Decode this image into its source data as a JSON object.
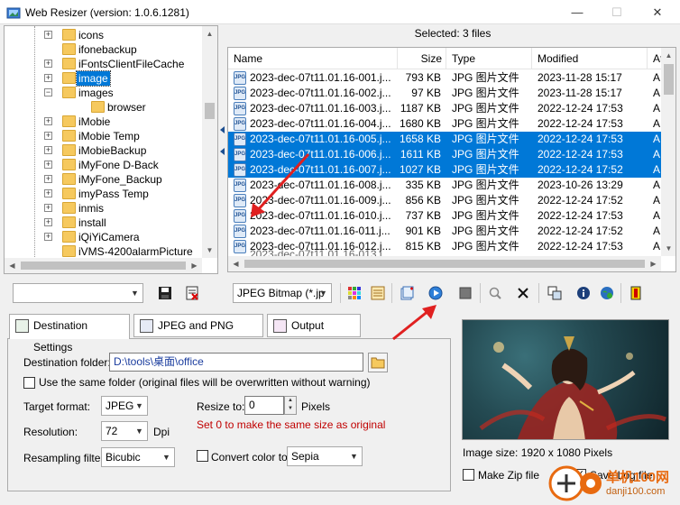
{
  "window": {
    "title": "Web Resizer (version: 1.0.6.1281)",
    "controls": {
      "minimize": "—",
      "maximize": "☐",
      "close": "✕"
    }
  },
  "tree": {
    "items": [
      {
        "label": "icons",
        "selected": false,
        "has_expander": true
      },
      {
        "label": "ifonebackup",
        "selected": false,
        "has_expander": false
      },
      {
        "label": "iFontsClientFileCache",
        "selected": false,
        "has_expander": true
      },
      {
        "label": "image",
        "selected": true,
        "has_expander": true
      },
      {
        "label": "images",
        "selected": false,
        "has_expander": true,
        "expanded": true
      },
      {
        "label": "browser",
        "selected": false,
        "has_expander": false,
        "child": true
      },
      {
        "label": "iMobie",
        "selected": false,
        "has_expander": true
      },
      {
        "label": "iMobie Temp",
        "selected": false,
        "has_expander": true
      },
      {
        "label": "iMobieBackup",
        "selected": false,
        "has_expander": true
      },
      {
        "label": "iMyFone D-Back",
        "selected": false,
        "has_expander": true
      },
      {
        "label": "iMyFone_Backup",
        "selected": false,
        "has_expander": true
      },
      {
        "label": "imyPass Temp",
        "selected": false,
        "has_expander": true
      },
      {
        "label": "inmis",
        "selected": false,
        "has_expander": true
      },
      {
        "label": "install",
        "selected": false,
        "has_expander": true
      },
      {
        "label": "iQiYiCamera",
        "selected": false,
        "has_expander": true
      },
      {
        "label": "iVMS-4200alarmPicture",
        "selected": false,
        "has_expander": false
      }
    ]
  },
  "file_list": {
    "selected_text": "Selected: 3 files",
    "columns": [
      "Name",
      "Size",
      "Type",
      "Modified",
      "Att"
    ],
    "rows": [
      {
        "name": "2023-dec-07t11.01.16-001.j...",
        "size": "793 KB",
        "type": "JPG 图片文件",
        "modified": "2023-11-28 15:17",
        "attr": "A",
        "selected": false
      },
      {
        "name": "2023-dec-07t11.01.16-002.j...",
        "size": "97 KB",
        "type": "JPG 图片文件",
        "modified": "2023-11-28 15:17",
        "attr": "A",
        "selected": false
      },
      {
        "name": "2023-dec-07t11.01.16-003.j...",
        "size": "1187 KB",
        "type": "JPG 图片文件",
        "modified": "2022-12-24 17:53",
        "attr": "A",
        "selected": false
      },
      {
        "name": "2023-dec-07t11.01.16-004.j...",
        "size": "1680 KB",
        "type": "JPG 图片文件",
        "modified": "2022-12-24 17:53",
        "attr": "A",
        "selected": false
      },
      {
        "name": "2023-dec-07t11.01.16-005.j...",
        "size": "1658 KB",
        "type": "JPG 图片文件",
        "modified": "2022-12-24 17:53",
        "attr": "A",
        "selected": true
      },
      {
        "name": "2023-dec-07t11.01.16-006.j...",
        "size": "1611 KB",
        "type": "JPG 图片文件",
        "modified": "2022-12-24 17:53",
        "attr": "A",
        "selected": true
      },
      {
        "name": "2023-dec-07t11.01.16-007.j...",
        "size": "1027 KB",
        "type": "JPG 图片文件",
        "modified": "2022-12-24 17:52",
        "attr": "A",
        "selected": true
      },
      {
        "name": "2023-dec-07t11.01.16-008.j...",
        "size": "335 KB",
        "type": "JPG 图片文件",
        "modified": "2023-10-26 13:29",
        "attr": "A",
        "selected": false
      },
      {
        "name": "2023-dec-07t11.01.16-009.j...",
        "size": "856 KB",
        "type": "JPG 图片文件",
        "modified": "2022-12-24 17:52",
        "attr": "A",
        "selected": false
      },
      {
        "name": "2023-dec-07t11.01.16-010.j...",
        "size": "737 KB",
        "type": "JPG 图片文件",
        "modified": "2022-12-24 17:53",
        "attr": "A",
        "selected": false
      },
      {
        "name": "2023-dec-07t11.01.16-011.j...",
        "size": "901 KB",
        "type": "JPG 图片文件",
        "modified": "2022-12-24 17:52",
        "attr": "A",
        "selected": false
      },
      {
        "name": "2023-dec-07t11.01.16-012.j...",
        "size": "815 KB",
        "type": "JPG 图片文件",
        "modified": "2022-12-24 17:53",
        "attr": "A",
        "selected": false
      }
    ]
  },
  "toolbar": {
    "format_combo": "JPEG Bitmap (*.jp"
  },
  "tabs": [
    {
      "label": "Destination Settings",
      "active": true
    },
    {
      "label": "JPEG and PNG Settings",
      "active": false
    },
    {
      "label": "Output Options",
      "active": false
    }
  ],
  "settings": {
    "destination_label": "Destination folder:",
    "destination_value": "D:\\tools\\桌面\\office",
    "same_folder_label": "Use the same folder (original files will be overwritten without warning)",
    "target_format_label": "Target format:",
    "target_format_value": "JPEG",
    "resize_label": "Resize to:",
    "resize_value": "0",
    "resize_unit": "Pixels",
    "resize_note": "Set 0 to make the same size as original",
    "resolution_label": "Resolution:",
    "resolution_value": "72",
    "resolution_unit": "Dpi",
    "resampling_label": "Resampling filter:",
    "resampling_value": "Bicubic",
    "convert_color_label": "Convert color to:",
    "convert_color_value": "Sepia"
  },
  "preview": {
    "image_size_text": "Image size: 1920 x 1080 Pixels",
    "make_zip_label": "Make Zip file",
    "save_log_label": "Save Log file",
    "save_log_checked": true
  },
  "watermark": {
    "brand": "单机100网",
    "url": "danji100.com"
  },
  "colors": {
    "selection": "#0078d7",
    "annotation_arrow": "#e02020",
    "note_red": "#c00000"
  }
}
